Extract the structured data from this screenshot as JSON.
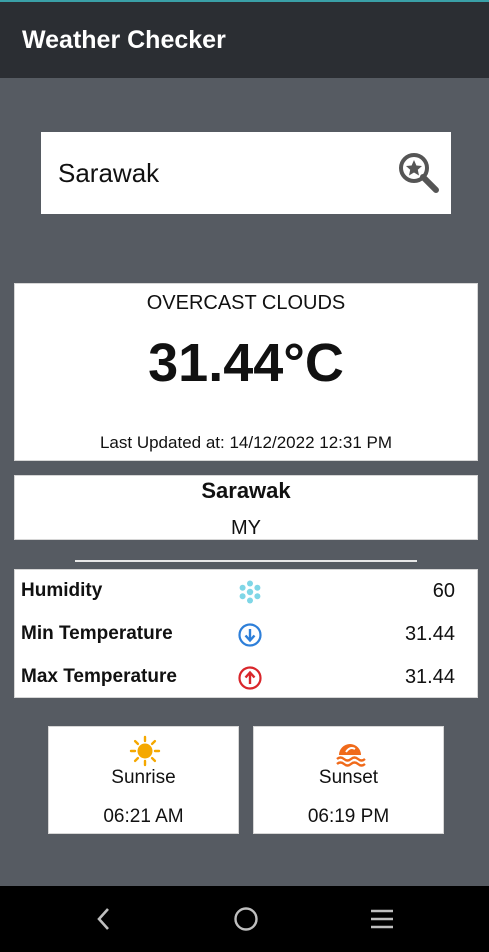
{
  "app": {
    "title": "Weather Checker"
  },
  "search": {
    "value": "Sarawak",
    "icon": "search-star-icon"
  },
  "weather": {
    "condition": "OVERCAST CLOUDS",
    "temperature": "31.44°C",
    "last_updated": "Last Updated at: 14/12/2022 12:31 PM"
  },
  "location": {
    "name": "Sarawak",
    "country": "MY"
  },
  "stats": {
    "humidity": {
      "label": "Humidity",
      "value": "60",
      "icon": "snowflake-icon"
    },
    "min_temp": {
      "label": "Min Temperature",
      "value": "31.44",
      "icon": "arrow-down-circle-icon"
    },
    "max_temp": {
      "label": "Max Temperature",
      "value": "31.44",
      "icon": "arrow-up-circle-icon"
    }
  },
  "sunrise": {
    "label": "Sunrise",
    "time": "06:21 AM",
    "icon": "sun-icon"
  },
  "sunset": {
    "label": "Sunset",
    "time": "06:19 PM",
    "icon": "sunset-icon"
  },
  "colors": {
    "background": "#565b62",
    "appbar": "#2b2e33",
    "humidity_icon": "#7fd6e6",
    "min_icon": "#2e7fd9",
    "max_icon": "#d9262b",
    "sunrise_icon": "#f5a800",
    "sunset_icon": "#f06a1a"
  }
}
